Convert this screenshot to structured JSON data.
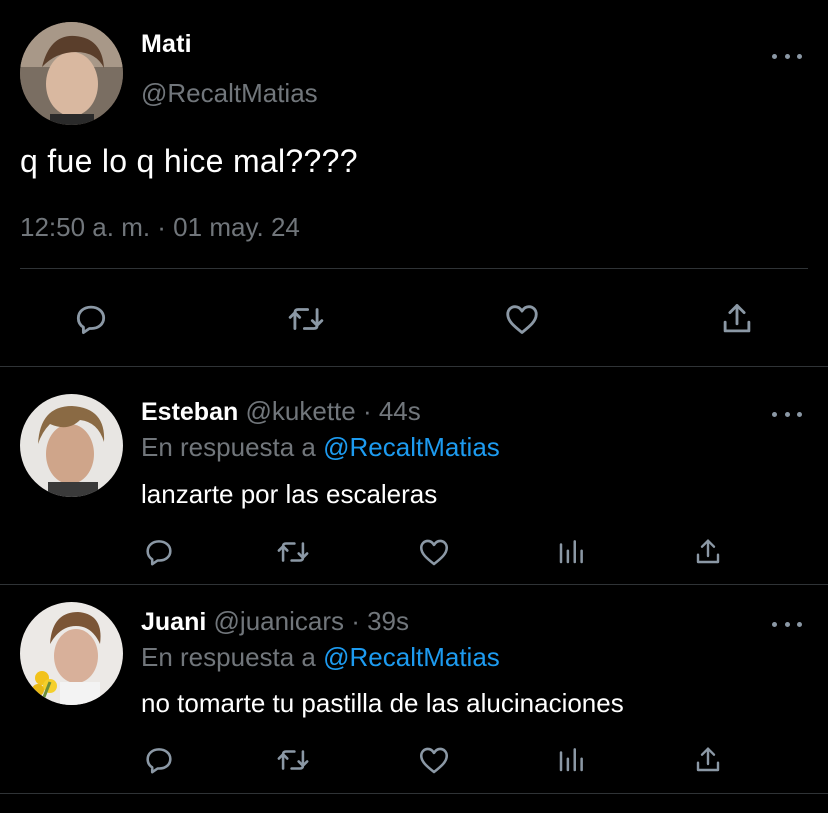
{
  "main_tweet": {
    "author_name": "Mati",
    "author_handle": "@RecaltMatias",
    "text": "q fue lo q hice mal????",
    "timestamp": "12:50 a. m. · 01 may. 24",
    "actions": [
      "reply-icon",
      "retweet-icon",
      "like-icon",
      "share-icon"
    ]
  },
  "replies": [
    {
      "author_name": "Esteban",
      "author_handle": "@kukette",
      "age": "· 44s",
      "reply_prefix": "En respuesta a",
      "reply_mention": "@RecaltMatias",
      "text": "lanzarte por las escaleras",
      "actions": [
        "reply-icon",
        "retweet-icon",
        "like-icon",
        "analytics-icon",
        "share-icon"
      ]
    },
    {
      "author_name": "Juani",
      "author_handle": "@juanicars",
      "age": "· 39s",
      "reply_prefix": "En respuesta a",
      "reply_mention": "@RecaltMatias",
      "text": "no tomarte tu pastilla de las alucinaciones",
      "actions": [
        "reply-icon",
        "retweet-icon",
        "like-icon",
        "analytics-icon",
        "share-icon"
      ]
    }
  ],
  "colors": {
    "background": "#000000",
    "primary_text": "#ffffff",
    "secondary_text": "#71767b",
    "mention": "#1d9bf0",
    "divider": "#2f3336",
    "icon": "#8b98a5"
  }
}
